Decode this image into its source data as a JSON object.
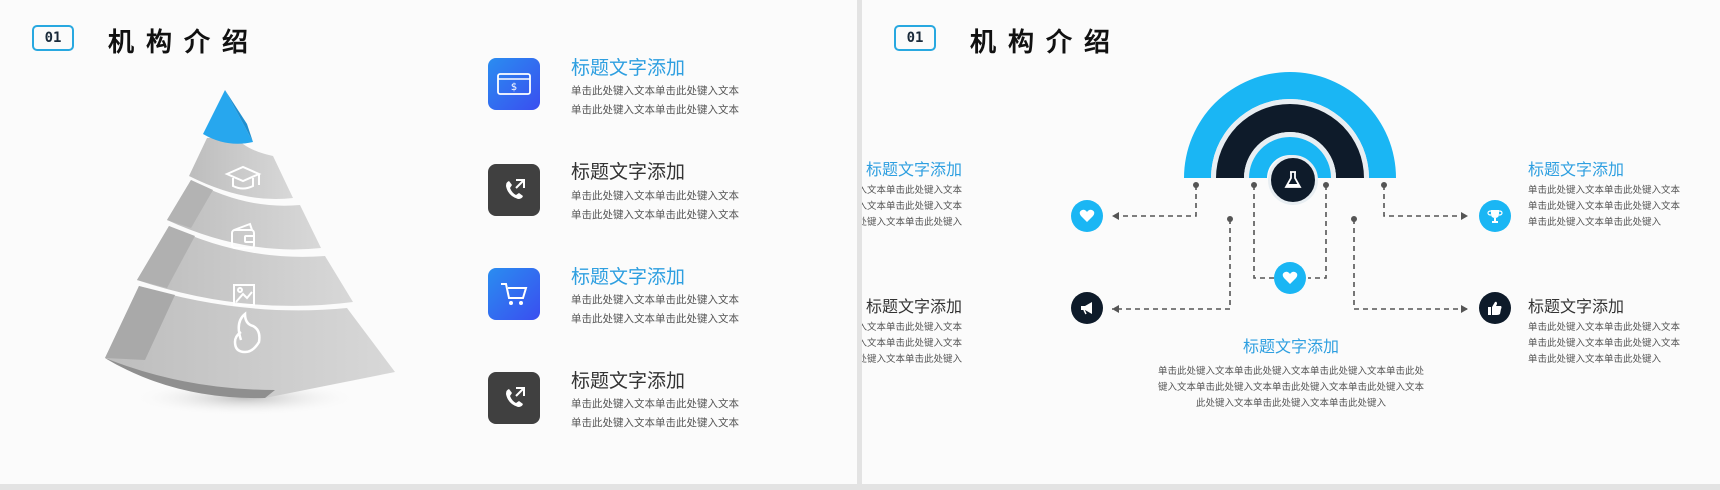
{
  "badge": "01",
  "page_title": "机构介绍",
  "left": {
    "items": [
      {
        "title": "标题文字添加",
        "line1": "单击此处键入文本单击此处键入文本",
        "line2": "单击此处键入文本单击此处键入文本",
        "icon": "dollar-card-icon"
      },
      {
        "title": "标题文字添加",
        "line1": "单击此处键入文本单击此处键入文本",
        "line2": "单击此处键入文本单击此处键入文本",
        "icon": "phone-call-icon"
      },
      {
        "title": "标题文字添加",
        "line1": "单击此处键入文本单击此处键入文本",
        "line2": "单击此处键入文本单击此处键入文本",
        "icon": "shopping-cart-icon"
      },
      {
        "title": "标题文字添加",
        "line1": "单击此处键入文本单击此处键入文本",
        "line2": "单击此处键入文本单击此处键入文本",
        "icon": "phone-call-icon"
      }
    ],
    "pyramid_icons": [
      "graduation-cap-icon",
      "wallet-icon",
      "picture-icon",
      "flame-icon"
    ]
  },
  "right": {
    "top_left": {
      "title": "标题文字添加",
      "line1": "单击此处键入文本单击此处键入文本",
      "line2": "单击此处键入文本单击此处键入文本",
      "line3": "单击此处键入文本单击此处键入"
    },
    "bottom_left": {
      "title": "标题文字添加",
      "line1": "单击此处键入文本单击此处键入文本",
      "line2": "单击此处键入文本单击此处键入文本",
      "line3": "单击此处键入文本单击此处键入"
    },
    "top_right": {
      "title": "标题文字添加",
      "line1": "单击此处键入文本单击此处键入文本",
      "line2": "单击此处键入文本单击此处键入文本",
      "line3": "单击此处键入文本单击此处键入"
    },
    "bottom_right": {
      "title": "标题文字添加",
      "line1": "单击此处键入文本单击此处键入文本",
      "line2": "单击此处键入文本单击此处键入文本",
      "line3": "单击此处键入文本单击此处键入"
    },
    "center": {
      "title": "标题文字添加",
      "line1": "单击此处键入文本单击此处键入文本单击此处键入文本单击此处",
      "line2": "键入文本单击此处键入文本单击此处键入文本单击此处键入文本",
      "line3": "此处键入文本单击此处键入文本单击此处键入"
    },
    "icons": [
      "flask-icon",
      "heart-icon",
      "megaphone-icon",
      "trophy-icon",
      "thumbs-up-icon"
    ]
  },
  "colors": {
    "accent_blue": "#2e9fe0",
    "cyan": "#1ab6f4",
    "navy": "#0e1b2a",
    "dark_tile": "#404040"
  }
}
